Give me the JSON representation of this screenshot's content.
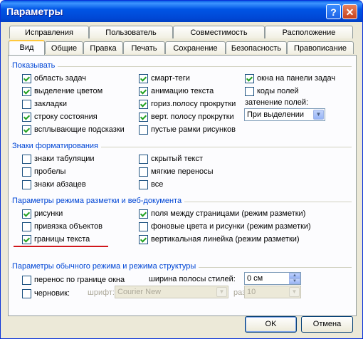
{
  "window": {
    "title": "Параметры",
    "help_label": "?",
    "close_label": "✕"
  },
  "tabs_back": [
    "Исправления",
    "Пользователь",
    "Совместимость",
    "Расположение"
  ],
  "tabs_front": [
    "Вид",
    "Общие",
    "Правка",
    "Печать",
    "Сохранение",
    "Безопасность",
    "Правописание"
  ],
  "active_tab": "Вид",
  "show": {
    "title": "Показывать",
    "col1": [
      {
        "label": "область задач",
        "checked": true
      },
      {
        "label": "выделение цветом",
        "checked": true
      },
      {
        "label": "закладки",
        "checked": false
      },
      {
        "label": "строку состояния",
        "checked": true
      },
      {
        "label": "всплывающие подсказки",
        "checked": true
      }
    ],
    "col2": [
      {
        "label": "смарт-теги",
        "checked": true
      },
      {
        "label": "анимацию текста",
        "checked": true
      },
      {
        "label": "гориз.полосу прокрутки",
        "checked": true
      },
      {
        "label": "верт. полосу прокрутки",
        "checked": true
      },
      {
        "label": "пустые рамки рисунков",
        "checked": false
      }
    ],
    "col3": [
      {
        "label": "окна на панели задач",
        "checked": true
      },
      {
        "label": "коды полей",
        "checked": false
      }
    ],
    "shading_label": "затенение полей:",
    "shading_value": "При выделении"
  },
  "formatting": {
    "title": "Знаки форматирования",
    "col1": [
      {
        "label": "знаки табуляции",
        "checked": false
      },
      {
        "label": "пробелы",
        "checked": false
      },
      {
        "label": "знаки абзацев",
        "checked": false
      }
    ],
    "col2": [
      {
        "label": "скрытый текст",
        "checked": false
      },
      {
        "label": "мягкие переносы",
        "checked": false
      },
      {
        "label": "все",
        "checked": false
      }
    ]
  },
  "layout": {
    "title": "Параметры режима разметки и веб-документа",
    "col1": [
      {
        "label": "рисунки",
        "checked": true
      },
      {
        "label": "привязка объектов",
        "checked": false
      },
      {
        "label": "границы текста",
        "checked": true
      }
    ],
    "col2": [
      {
        "label": "поля между страницами (режим разметки)",
        "checked": true
      },
      {
        "label": "фоновые цвета и рисунки (режим разметки)",
        "checked": false
      },
      {
        "label": "вертикальная линейка (режим разметки)",
        "checked": true
      }
    ]
  },
  "normal": {
    "title": "Параметры обычного режима и режима структуры",
    "wrap": {
      "label": "перенос по границе окна",
      "checked": false
    },
    "draft": {
      "label": "черновик:",
      "checked": false
    },
    "style_width_label": "ширина полосы стилей:",
    "style_width_value": "0 см",
    "font_label": "шрифт:",
    "font_value": "Courier New",
    "size_label": "размер:",
    "size_value": "10"
  },
  "buttons": {
    "ok": "OK",
    "cancel": "Отмена"
  }
}
